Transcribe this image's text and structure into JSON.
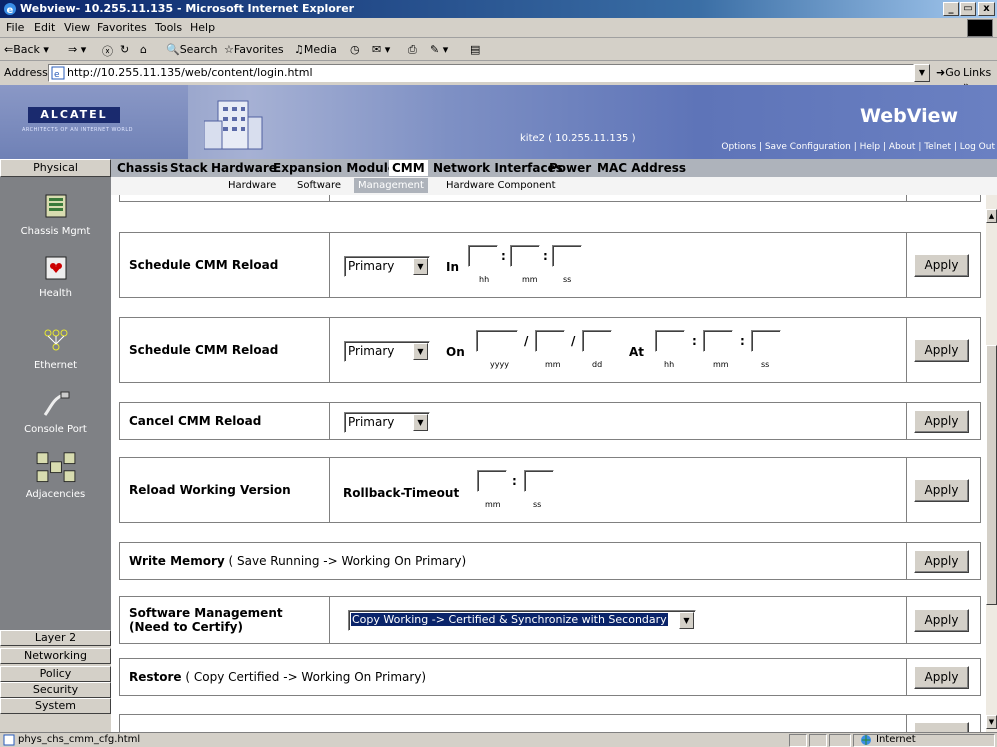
{
  "window": {
    "title": "Webview- 10.255.11.135 - Microsoft Internet Explorer"
  },
  "menu": [
    "File",
    "Edit",
    "View",
    "Favorites",
    "Tools",
    "Help"
  ],
  "toolbar": {
    "back": "Back",
    "search": "Search",
    "favorites": "Favorites",
    "media": "Media"
  },
  "address": {
    "label": "Address",
    "url": "http://10.255.11.135/web/content/login.html",
    "go": "Go",
    "links": "Links"
  },
  "header": {
    "brand": "ALCATEL",
    "tagline": "ARCHITECTS OF AN INTERNET WORLD",
    "host": "kite2 ( 10.255.11.135 )",
    "app_name": "WebView",
    "links": "Options | Save Configuration | Help | About | Telnet | Log Out"
  },
  "sidebar": {
    "category_physical": "Physical",
    "items": [
      "Chassis Mgmt",
      "Health",
      "Ethernet",
      "Console Port",
      "Adjacencies"
    ],
    "categories": [
      "Layer 2",
      "Networking",
      "Policy",
      "Security",
      "System"
    ]
  },
  "topnav": [
    "Chassis",
    "Stack",
    "Hardware",
    "Expansion Modules",
    "CMM",
    "Network Interfaces",
    "Power",
    "MAC Address"
  ],
  "subnav": [
    "Hardware",
    "Software",
    "Management",
    "Hardware Component"
  ],
  "rows": {
    "r1": {
      "label": "Schedule CMM Reload",
      "select": "Primary",
      "in": "In",
      "hh": "hh",
      "mm": "mm",
      "ss": "ss",
      "apply": "Apply"
    },
    "r2": {
      "label": "Schedule CMM Reload",
      "select": "Primary",
      "on": "On",
      "at": "At",
      "yyyy": "yyyy",
      "mm": "mm",
      "dd": "dd",
      "hh": "hh",
      "mm2": "mm",
      "ss": "ss",
      "apply": "Apply"
    },
    "r3": {
      "label": "Cancel CMM Reload",
      "select": "Primary",
      "apply": "Apply"
    },
    "r4": {
      "label": "Reload Working Version",
      "rollback": "Rollback-Timeout",
      "mm": "mm",
      "ss": "ss",
      "apply": "Apply"
    },
    "r5": {
      "label_bold": "Write Memory",
      "label_rest": " ( Save Running -> Working On Primary)",
      "apply": "Apply"
    },
    "r6": {
      "label_line1": "Software Management",
      "label_line2": "(Need to Certify)",
      "select": "Copy Working -> Certified & Synchronize with Secondary",
      "apply": "Apply"
    },
    "r7": {
      "label_bold": "Restore",
      "label_rest": " ( Copy Certified -> Working On Primary)",
      "apply": "Apply"
    }
  },
  "status": {
    "file": "phys_chs_cmm_cfg.html",
    "zone": "Internet"
  },
  "colors": {
    "nav_bar": "#aeb3bb",
    "sidebar": "#7f8185",
    "title_start": "#0a246a"
  }
}
